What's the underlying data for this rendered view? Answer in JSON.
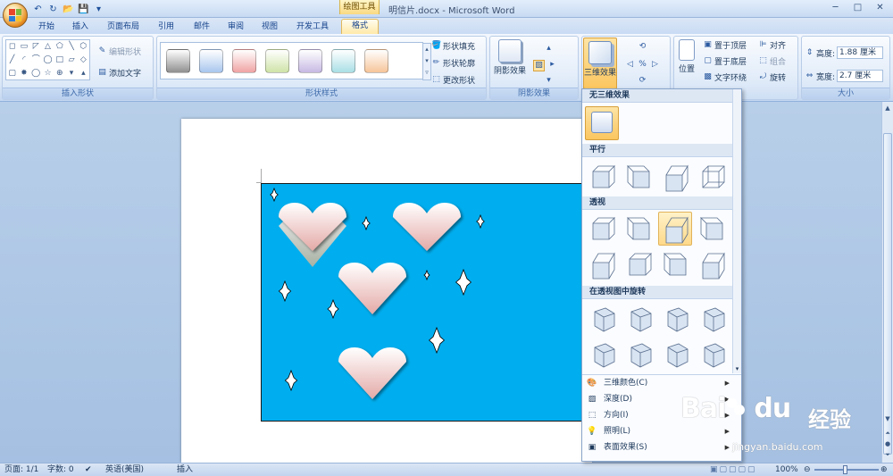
{
  "window": {
    "title": "明信片.docx - Microsoft Word",
    "context_tab": "绘图工具",
    "minimize": "─",
    "maximize": "□",
    "close": "✕"
  },
  "quick_access": {
    "undo": "↶",
    "redo": "↻",
    "open": "📂",
    "save": "💾",
    "customize": "▾"
  },
  "tabs": [
    {
      "label": "开始"
    },
    {
      "label": "插入"
    },
    {
      "label": "页面布局"
    },
    {
      "label": "引用"
    },
    {
      "label": "邮件"
    },
    {
      "label": "审阅"
    },
    {
      "label": "视图"
    },
    {
      "label": "开发工具"
    },
    {
      "label": "格式",
      "active": true
    }
  ],
  "ribbon": {
    "insert_shapes": {
      "label": "插入形状",
      "shapes": [
        "◻",
        "▭",
        "◸",
        "△",
        "⬠",
        "╲",
        "⬡",
        "╱",
        "◜",
        "⌒",
        "◯",
        "□",
        "▱",
        "◇",
        "▢",
        "✸",
        "◯",
        "☆",
        "⊕",
        "▾",
        "▴"
      ],
      "edit_shape": "编辑形状",
      "add_text": "添加文字"
    },
    "shape_styles": {
      "label": "形状样式",
      "fill": "形状填充",
      "outline": "形状轮廓",
      "change": "更改形状",
      "swatches": [
        "#8f8f8f",
        "#a8c6ee",
        "#f0a3a3",
        "#cfe3a7",
        "#c7b9e3",
        "#a9dfe6",
        "#f6c59a"
      ]
    },
    "shadow": {
      "label": "阴影效果",
      "button": "阴影效果"
    },
    "effects_3d": {
      "button": "三维效果"
    },
    "arrange": {
      "position": "位置",
      "bring_front": "置于顶层",
      "send_back": "置于底层",
      "wrap": "文字环绕",
      "align": "对齐",
      "group": "组合",
      "rotate": "旋转"
    },
    "size": {
      "label": "大小",
      "height_label": "高度:",
      "height_value": "1.88 厘米",
      "width_label": "宽度:",
      "width_value": "2.7 厘米"
    }
  },
  "dropdown_3d": {
    "section_none": "无三维效果",
    "section_parallel": "平行",
    "section_perspective": "透视",
    "section_rotate": "在透视图中旋转",
    "menu": [
      {
        "icon": "🎨",
        "label": "三维颜色(C)",
        "submenu": true
      },
      {
        "icon": "▨",
        "label": "深度(D)",
        "submenu": true
      },
      {
        "icon": "⬚",
        "label": "方向(I)",
        "submenu": true
      },
      {
        "icon": "💡",
        "label": "照明(L)",
        "submenu": true
      },
      {
        "icon": "▣",
        "label": "表面效果(S)",
        "submenu": true
      }
    ]
  },
  "status": {
    "page": "页面: 1/1",
    "words": "字数: 0",
    "language": "英语(美国)",
    "mode": "插入",
    "zoom": "100%",
    "zoom_minus": "⊖",
    "zoom_plus": "⊕"
  },
  "watermark": {
    "logo": "Bai",
    "logo2": "du",
    "site": "经验",
    "url": "jingyan.baidu.com"
  },
  "colors": {
    "card_bg": "#00aeef",
    "accent": "#fbc65f",
    "ribbon": "#dce8f7"
  }
}
